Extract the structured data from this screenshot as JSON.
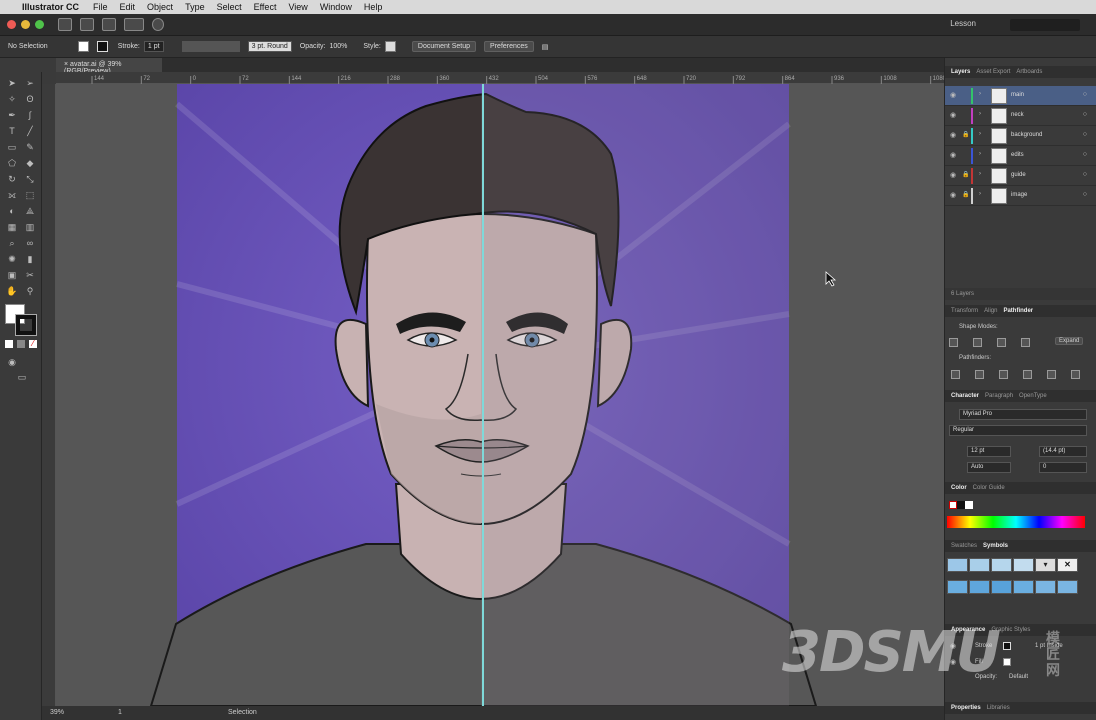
{
  "menubar": {
    "app_name": "Illustrator CC",
    "items": [
      "File",
      "Edit",
      "Object",
      "Type",
      "Select",
      "Effect",
      "View",
      "Window",
      "Help"
    ]
  },
  "appbar": {
    "workspace": "Lesson"
  },
  "controlbar": {
    "selection": "No Selection",
    "stroke_label": "Stroke:",
    "stroke_value": "1 pt",
    "brush": "3 pt. Round",
    "opacity_label": "Opacity:",
    "opacity_value": "100%",
    "style_label": "Style:",
    "document_setup": "Document Setup",
    "preferences": "Preferences"
  },
  "document": {
    "tab_title": "avatar.ai @ 39% (RGB/Preview)"
  },
  "ruler": {
    "ticks": [
      "144",
      "72",
      "0",
      "72",
      "144",
      "216",
      "288",
      "360",
      "432",
      "504",
      "576",
      "648",
      "720",
      "792",
      "864",
      "936",
      "1008",
      "1080"
    ]
  },
  "statusbar": {
    "zoom": "39%",
    "artboard": "1",
    "tool": "Selection"
  },
  "panels": {
    "layers_tabs": [
      "Layers",
      "Asset Export",
      "Artboards"
    ],
    "layers": [
      {
        "name": "main",
        "color": "#33c46a",
        "locked": false,
        "selected": true
      },
      {
        "name": "neck",
        "color": "#c23ec0",
        "locked": false,
        "selected": false
      },
      {
        "name": "background",
        "color": "#35c9c4",
        "locked": true,
        "selected": false
      },
      {
        "name": "edits",
        "color": "#3b55d6",
        "locked": false,
        "selected": false
      },
      {
        "name": "guide",
        "color": "#c23636",
        "locked": true,
        "selected": false
      },
      {
        "name": "image",
        "color": "#cfcfcf",
        "locked": true,
        "selected": false
      }
    ],
    "layers_count": "6 Layers",
    "transform_tabs": [
      "Transform",
      "Align",
      "Pathfinder"
    ],
    "shape_modes": "Shape Modes:",
    "expand": "Expand",
    "pathfinders": "Pathfinders:",
    "character_tabs": [
      "Character",
      "Paragraph",
      "OpenType"
    ],
    "font": "Myriad Pro",
    "font_style": "Regular",
    "font_size": "12 pt",
    "leading": "(14.4 pt)",
    "kerning": "Auto",
    "tracking": "0",
    "color_tabs": [
      "Color",
      "Color Guide"
    ],
    "swatch_tabs": [
      "Swatches",
      "Symbols"
    ],
    "appearance_tabs": [
      "Appearance",
      "Graphic Styles"
    ],
    "appearance_stroke": "Stroke",
    "appearance_stroke_value": "1 pt Inside",
    "appearance_fill": "Fill",
    "appearance_opacity": "Opacity:",
    "appearance_opacity_value": "Default",
    "properties_tabs": [
      "Properties",
      "Libraries"
    ]
  },
  "watermark": {
    "logo": "3DSMU",
    "cn": "模匠网"
  },
  "colors": {
    "artboard": "#6a52b8",
    "skin": "#c9b3b3",
    "hair": "#3a3333",
    "shirt": "#575757",
    "guide": "#7fd9d9"
  }
}
